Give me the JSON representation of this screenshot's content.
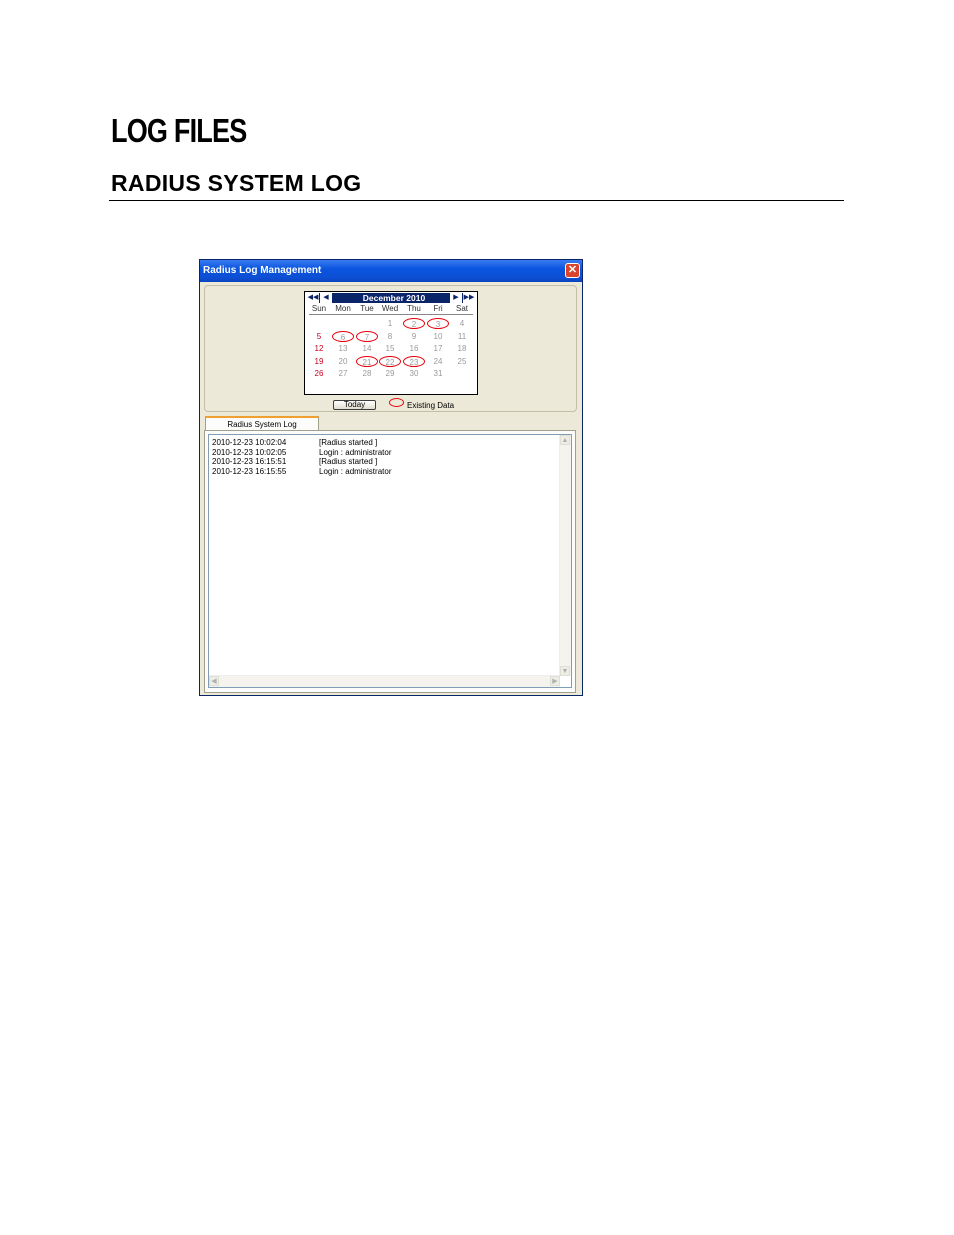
{
  "document": {
    "heading": "LOG FILES",
    "subheading": "RADIUS SYSTEM LOG"
  },
  "window": {
    "title": "Radius Log Management",
    "close_glyph": "✕"
  },
  "calendar": {
    "month_label": "December 2010",
    "nav": {
      "first": "◀◀",
      "prev": "◀",
      "next": "▶",
      "last": "▶▶"
    },
    "weekdays": [
      "Sun",
      "Mon",
      "Tue",
      "Wed",
      "Thu",
      "Fri",
      "Sat"
    ],
    "weeks": [
      [
        "",
        "",
        "",
        "1",
        "2",
        "3",
        "4"
      ],
      [
        "5",
        "6",
        "7",
        "8",
        "9",
        "10",
        "11"
      ],
      [
        "12",
        "13",
        "14",
        "15",
        "16",
        "17",
        "18"
      ],
      [
        "19",
        "20",
        "21",
        "22",
        "23",
        "24",
        "25"
      ],
      [
        "26",
        "27",
        "28",
        "29",
        "30",
        "31",
        ""
      ]
    ],
    "existing_data_days": [
      "2",
      "3",
      "6",
      "7",
      "21",
      "22",
      "23"
    ],
    "sunday_color": "#c8001e",
    "marker_color": "#e8000a",
    "today_button": "Today",
    "legend_label": "Existing Data"
  },
  "tabs": [
    {
      "label": "Radius System Log",
      "selected": true
    }
  ],
  "log": {
    "entries": [
      {
        "timestamp": "2010-12-23 10:02:04",
        "message": "[Radius started ]"
      },
      {
        "timestamp": "2010-12-23 10:02:05",
        "message": "Login : administrator"
      },
      {
        "timestamp": "2010-12-23 16:15:51",
        "message": "[Radius started ]"
      },
      {
        "timestamp": "2010-12-23 16:15:55",
        "message": "Login : administrator"
      }
    ]
  }
}
